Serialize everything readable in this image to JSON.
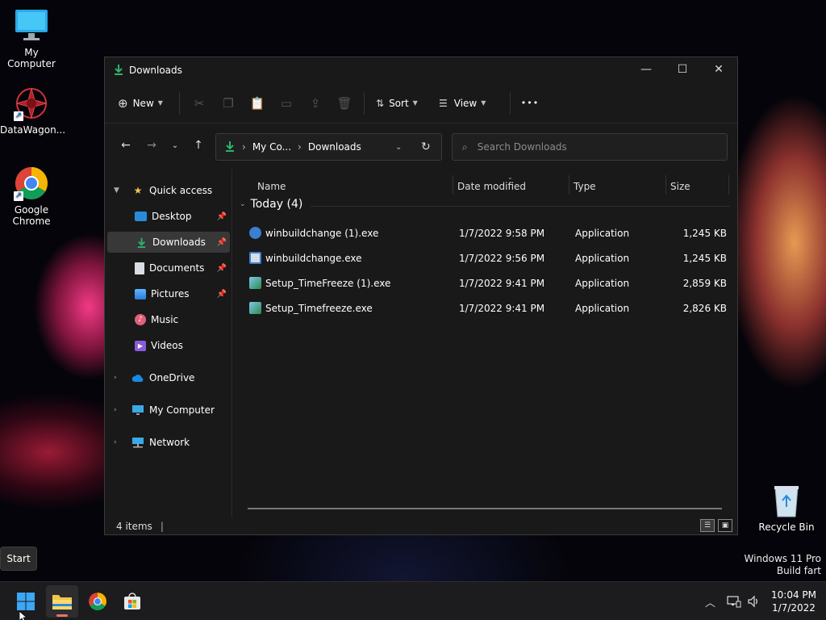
{
  "desktop": {
    "icons": [
      {
        "label": "My Computer",
        "icon": "monitor-icon"
      },
      {
        "label": "DataWagon...",
        "icon": "datawagon-icon"
      },
      {
        "label": "Google Chrome",
        "icon": "chrome-icon"
      },
      {
        "label": "Recycle Bin",
        "icon": "recycle-bin-icon"
      }
    ],
    "tooltip": "Start",
    "watermark": {
      "line1": "Windows 11 Pro",
      "line2": "Build fart"
    }
  },
  "window": {
    "title": "Downloads",
    "controls": {
      "minimize": "—",
      "maximize": "☐",
      "close": "✕"
    },
    "toolbar": {
      "new_label": "New",
      "sort_label": "Sort",
      "view_label": "View",
      "more_label": "•••"
    },
    "address": {
      "crumb1": "My Co...",
      "crumb2": "Downloads"
    },
    "search": {
      "placeholder": "Search Downloads"
    },
    "nav": {
      "quick_access": "Quick access",
      "items": [
        {
          "label": "Desktop",
          "pinned": true
        },
        {
          "label": "Downloads",
          "pinned": true,
          "selected": true
        },
        {
          "label": "Documents",
          "pinned": true
        },
        {
          "label": "Pictures",
          "pinned": true
        },
        {
          "label": "Music",
          "pinned": false
        },
        {
          "label": "Videos",
          "pinned": false
        }
      ],
      "onedrive": "OneDrive",
      "my_computer": "My Computer",
      "network": "Network"
    },
    "columns": {
      "name": "Name",
      "date": "Date modified",
      "type": "Type",
      "size": "Size"
    },
    "group": "Today (4)",
    "files": [
      {
        "name": "winbuildchange (1).exe",
        "date": "1/7/2022 9:58 PM",
        "type": "Application",
        "size": "1,245 KB"
      },
      {
        "name": "winbuildchange.exe",
        "date": "1/7/2022 9:56 PM",
        "type": "Application",
        "size": "1,245 KB"
      },
      {
        "name": "Setup_TimeFreeze (1).exe",
        "date": "1/7/2022 9:41 PM",
        "type": "Application",
        "size": "2,859 KB"
      },
      {
        "name": "Setup_Timefreeze.exe",
        "date": "1/7/2022 9:41 PM",
        "type": "Application",
        "size": "2,826 KB"
      }
    ],
    "status": "4 items"
  },
  "taskbar": {
    "clock_time": "10:04 PM",
    "clock_date": "1/7/2022"
  },
  "colors": {
    "accent": "#0078d4",
    "downloads_green": "#2fb36a",
    "folder_yellow": "#f2c54a"
  }
}
